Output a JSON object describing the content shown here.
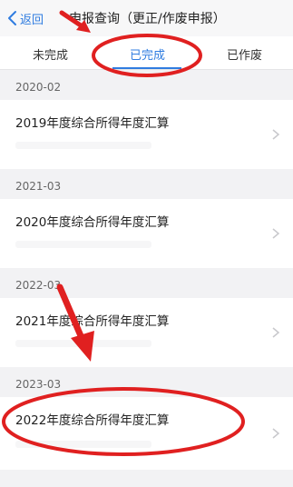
{
  "nav": {
    "back_label": "返回",
    "title": "申报查询（更正/作废申报）"
  },
  "tabs": [
    {
      "label": "未完成",
      "active": false
    },
    {
      "label": "已完成",
      "active": true
    },
    {
      "label": "已作废",
      "active": false
    }
  ],
  "groups": [
    {
      "date": "2020-02",
      "title": "2019年度综合所得年度汇算"
    },
    {
      "date": "2021-03",
      "title": "2020年度综合所得年度汇算"
    },
    {
      "date": "2022-03",
      "title": "2021年度综合所得年度汇算"
    },
    {
      "date": "2023-03",
      "title": "2022年度综合所得年度汇算"
    }
  ],
  "colors": {
    "accent": "#2f7ce0",
    "annotation": "#e02020",
    "background": "#f2f2f4"
  },
  "icons": {
    "back": "chevron-left-icon",
    "row_arrow": "chevron-right-icon"
  }
}
